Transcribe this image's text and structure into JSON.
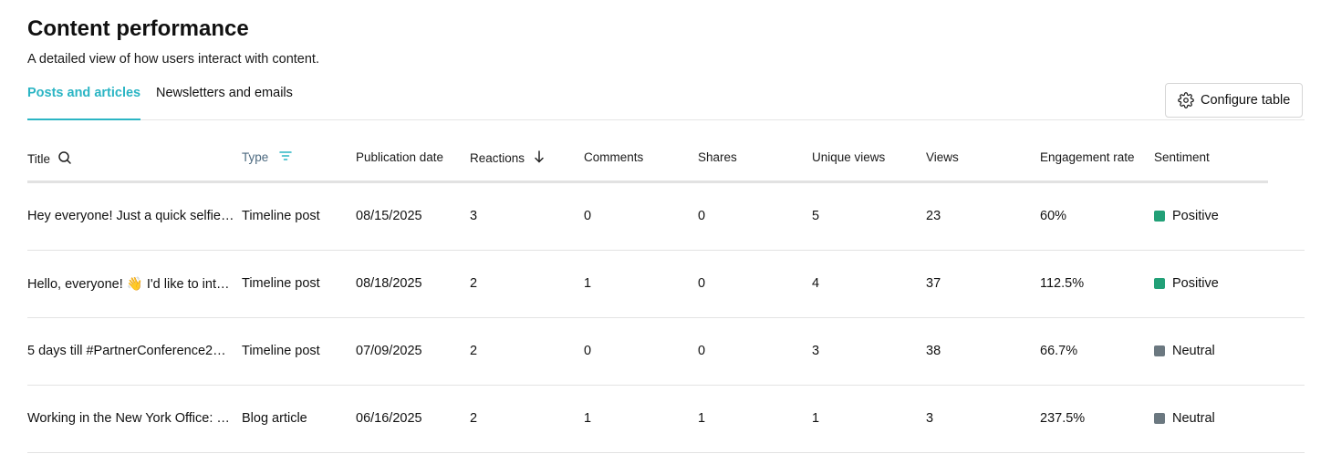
{
  "header": {
    "title": "Content performance",
    "subtitle": "A detailed view of how users interact with content."
  },
  "tabs": [
    {
      "label": "Posts and articles",
      "active": true
    },
    {
      "label": "Newsletters and emails",
      "active": false
    }
  ],
  "configure_button": {
    "label": "Configure table",
    "icon": "gear-icon"
  },
  "colors": {
    "accent": "#2bb5c4",
    "positive": "#22a077",
    "neutral": "#6b7880"
  },
  "table": {
    "columns": [
      {
        "label": "Title",
        "icon": "search-icon"
      },
      {
        "label": "Type",
        "icon": "filter-icon"
      },
      {
        "label": "Publication date"
      },
      {
        "label": "Reactions",
        "icon": "arrow-down-icon"
      },
      {
        "label": "Comments"
      },
      {
        "label": "Shares"
      },
      {
        "label": "Unique views"
      },
      {
        "label": "Views"
      },
      {
        "label": "Engagement rate"
      },
      {
        "label": "Sentiment"
      }
    ],
    "rows": [
      {
        "title": "Hey everyone! Just a quick selfie…",
        "type": "Timeline post",
        "date": "08/15/2025",
        "reactions": "3",
        "comments": "0",
        "shares": "0",
        "unique_views": "5",
        "views": "23",
        "engagement": "60%",
        "sentiment": "Positive",
        "sentiment_color": "#22a077"
      },
      {
        "title": "Hello, everyone! 👋 I'd like to int…",
        "type": "Timeline post",
        "date": "08/18/2025",
        "reactions": "2",
        "comments": "1",
        "shares": "0",
        "unique_views": "4",
        "views": "37",
        "engagement": "112.5%",
        "sentiment": "Positive",
        "sentiment_color": "#22a077"
      },
      {
        "title": "5 days till #PartnerConference2…",
        "type": "Timeline post",
        "date": "07/09/2025",
        "reactions": "2",
        "comments": "0",
        "shares": "0",
        "unique_views": "3",
        "views": "38",
        "engagement": "66.7%",
        "sentiment": "Neutral",
        "sentiment_color": "#6b7880"
      },
      {
        "title": "Working in the New York Office: …",
        "type": "Blog article",
        "date": "06/16/2025",
        "reactions": "2",
        "comments": "1",
        "shares": "1",
        "unique_views": "1",
        "views": "3",
        "engagement": "237.5%",
        "sentiment": "Neutral",
        "sentiment_color": "#6b7880"
      }
    ]
  }
}
